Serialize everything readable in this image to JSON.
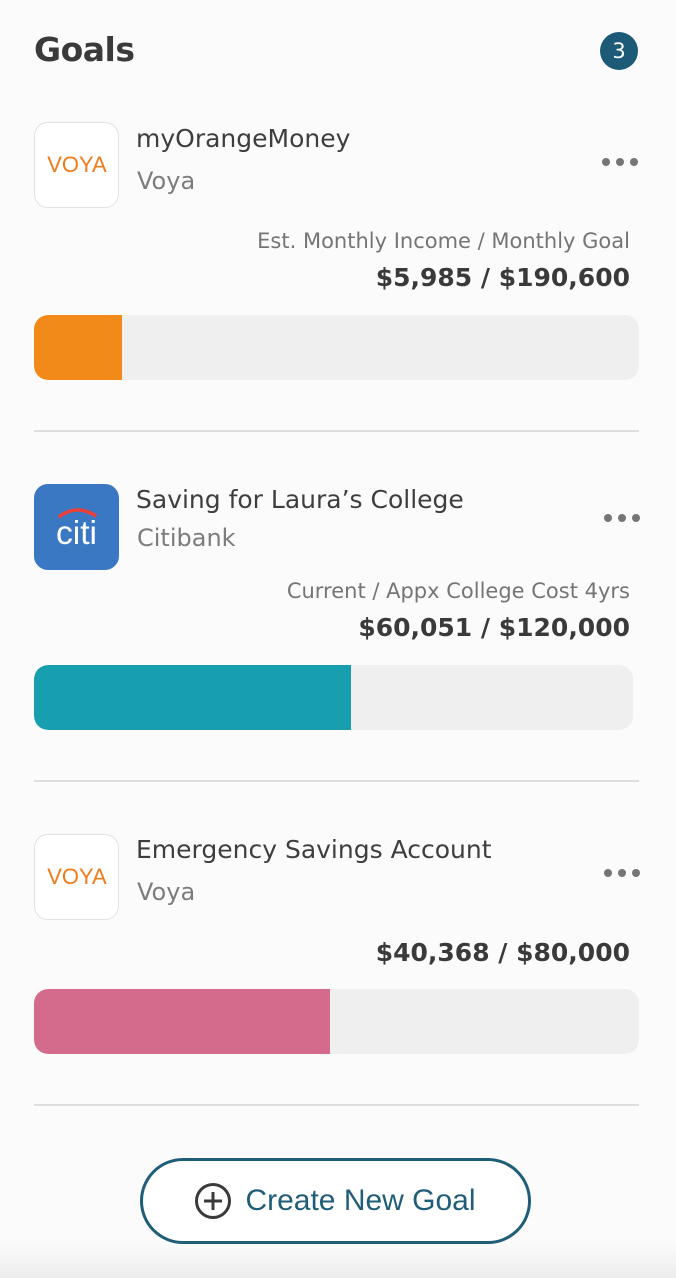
{
  "header": {
    "title": "Goals",
    "count": "3"
  },
  "goals": [
    {
      "name": "myOrangeMoney",
      "provider": "Voya",
      "logo_text": "VOYA",
      "logo_icon": "voya-logo",
      "metric_label": "Est. Monthly Income / Monthly Goal",
      "metric_value": "$5,985 / $190,600",
      "progress": 0.145,
      "bar_color": "#f28a1a"
    },
    {
      "name": "Saving for Laura’s College",
      "provider": "Citibank",
      "logo_text": "citi",
      "logo_icon": "citi-logo",
      "metric_label": "Current / Appx College Cost 4yrs",
      "metric_value": "$60,051 / $120,000",
      "progress": 0.53,
      "bar_color": "#179faf"
    },
    {
      "name": "Emergency Savings Account",
      "provider": "Voya",
      "logo_text": "VOYA",
      "logo_icon": "voya-logo",
      "metric_label": "",
      "metric_value": "$40,368 / $80,000",
      "progress": 0.49,
      "bar_color": "#d46b8c"
    }
  ],
  "create_button": {
    "label": "Create New Goal",
    "icon": "plus-circle-icon"
  },
  "colors": {
    "accent": "#1f5d78",
    "badge": "#1c5a78"
  }
}
